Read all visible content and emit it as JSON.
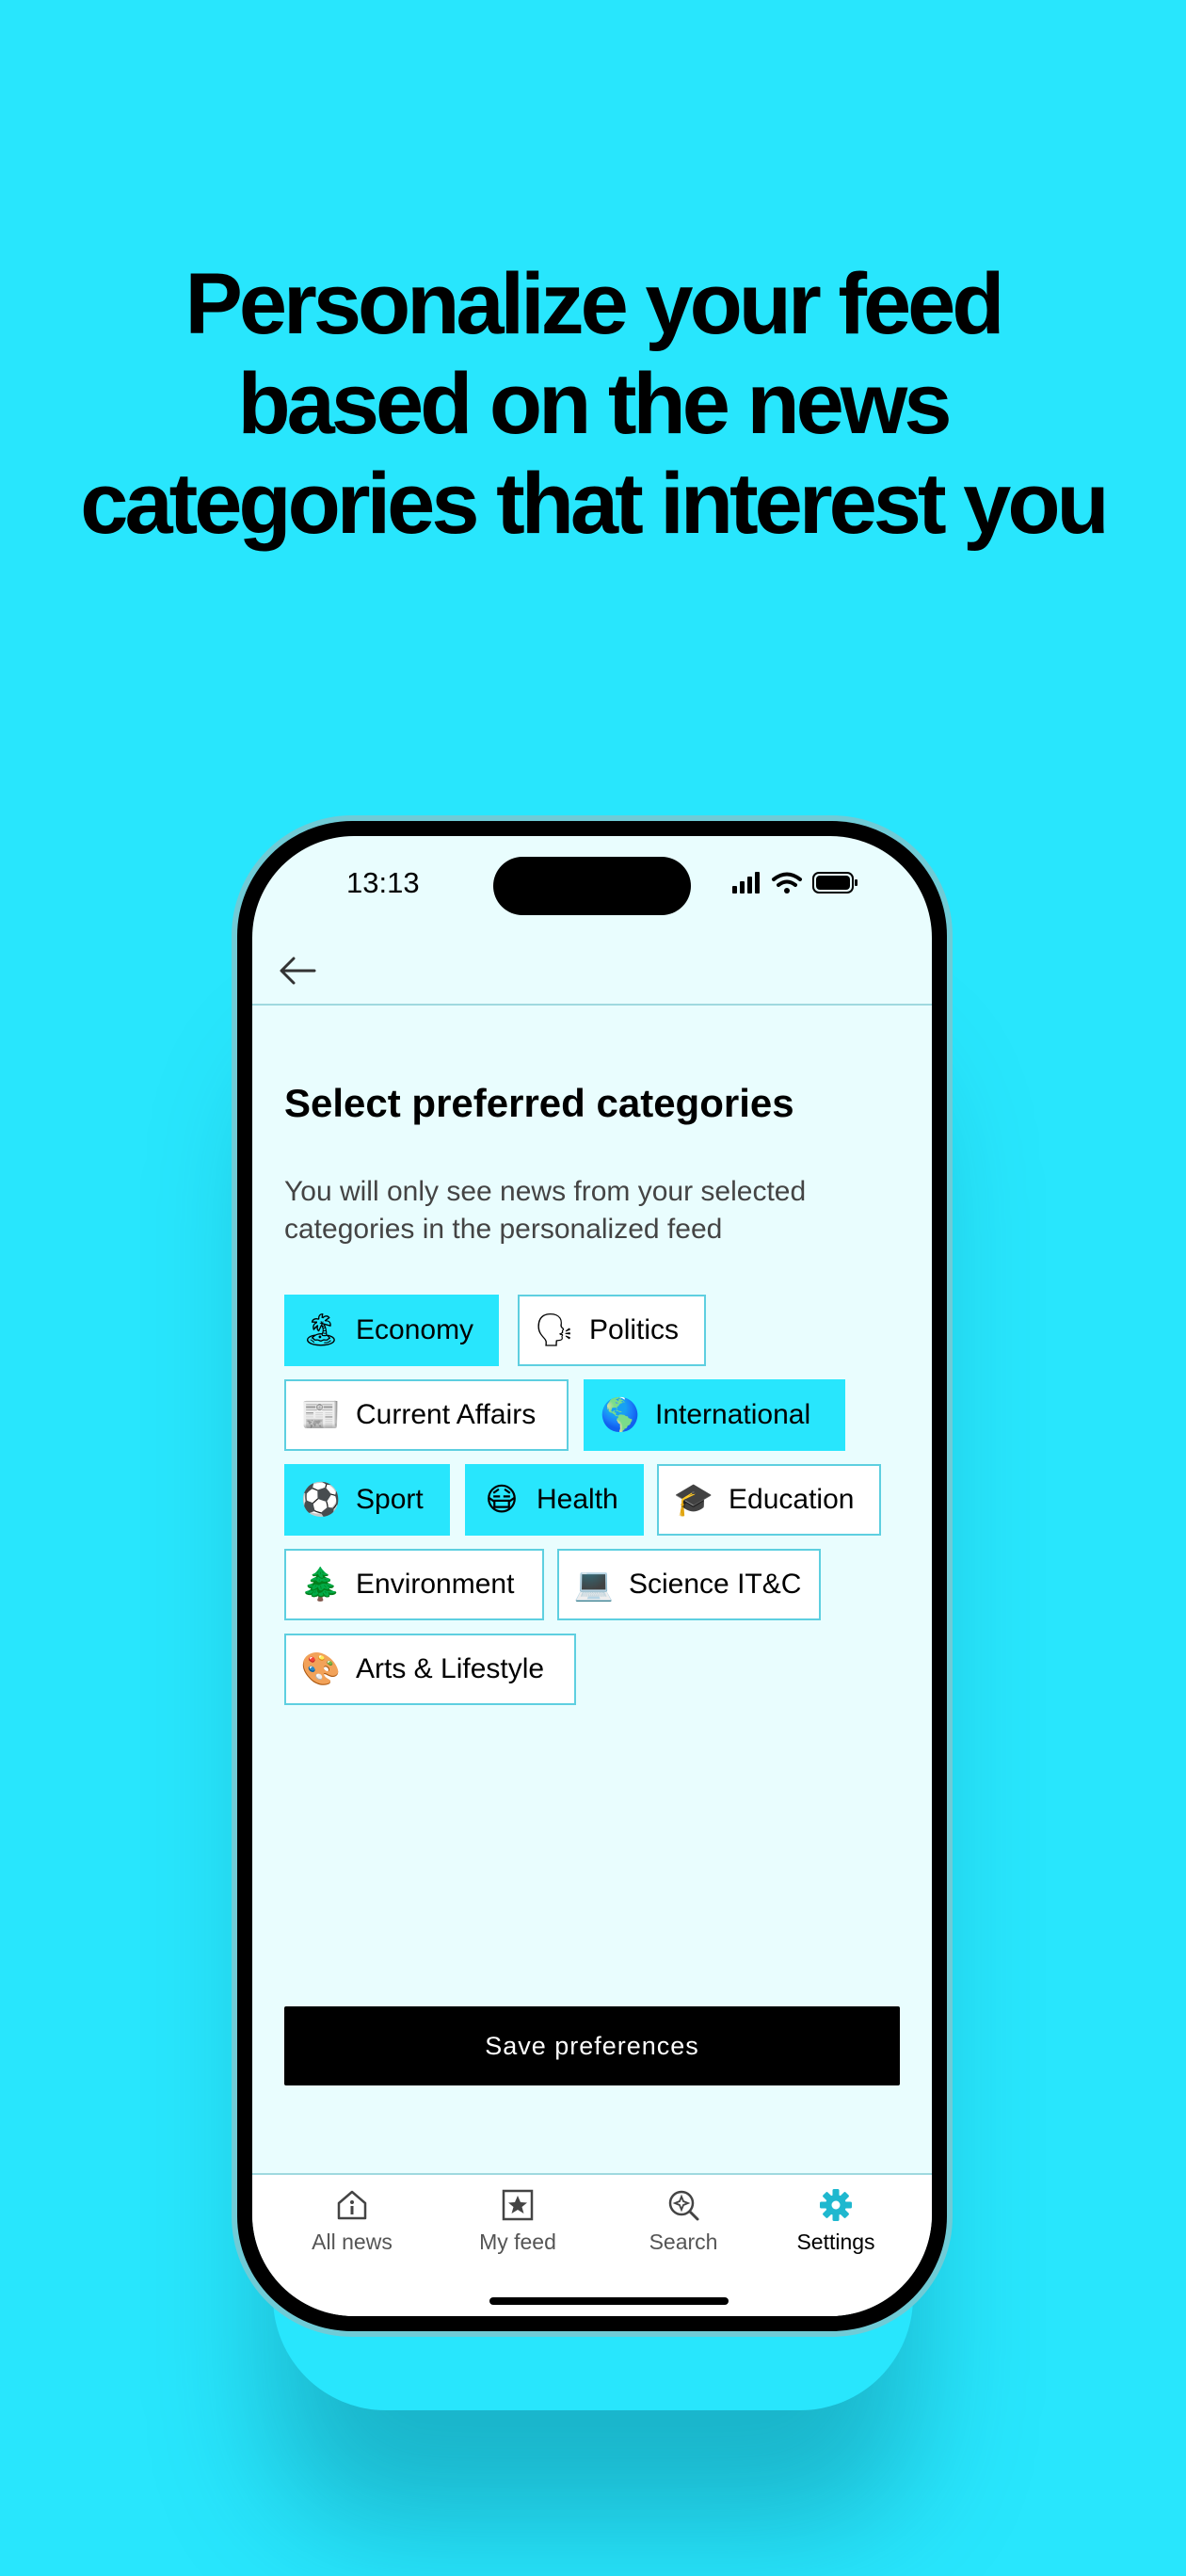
{
  "headline": {
    "line1": "Personalize your feed",
    "line2": "based on the news",
    "line3": "categories that interest you"
  },
  "status_bar": {
    "time": "13:13"
  },
  "page": {
    "title": "Select preferred categories",
    "subtitle": "You will only see news from your selected categories in the personalized feed"
  },
  "categories": [
    {
      "label": "Economy",
      "emoji": "🏝",
      "selected": true
    },
    {
      "label": "Politics",
      "emoji": "🗣",
      "selected": false
    },
    {
      "label": "Current Affairs",
      "emoji": "📰",
      "selected": false
    },
    {
      "label": "International",
      "emoji": "🌎",
      "selected": true
    },
    {
      "label": "Sport",
      "emoji": "⚽",
      "selected": true
    },
    {
      "label": "Health",
      "emoji": "😷",
      "selected": true
    },
    {
      "label": "Education",
      "emoji": "🎓",
      "selected": false
    },
    {
      "label": "Environment",
      "emoji": "🌲",
      "selected": false
    },
    {
      "label": "Science IT&C",
      "emoji": "💻",
      "selected": false
    },
    {
      "label": "Arts & Lifestyle",
      "emoji": "🎨",
      "selected": false
    }
  ],
  "save_button": {
    "label": "Save preferences"
  },
  "tabs": [
    {
      "label": "All news",
      "icon": "home-icon",
      "active": false
    },
    {
      "label": "My feed",
      "icon": "star-icon",
      "active": false
    },
    {
      "label": "Search",
      "icon": "search-icon",
      "active": false
    },
    {
      "label": "Settings",
      "icon": "gear-icon",
      "active": true
    }
  ],
  "colors": {
    "background": "#28e6fd",
    "selected_chip": "#28e6fd",
    "chip_border": "#5ecfe0",
    "active_tab_icon": "#1fb8cf"
  }
}
